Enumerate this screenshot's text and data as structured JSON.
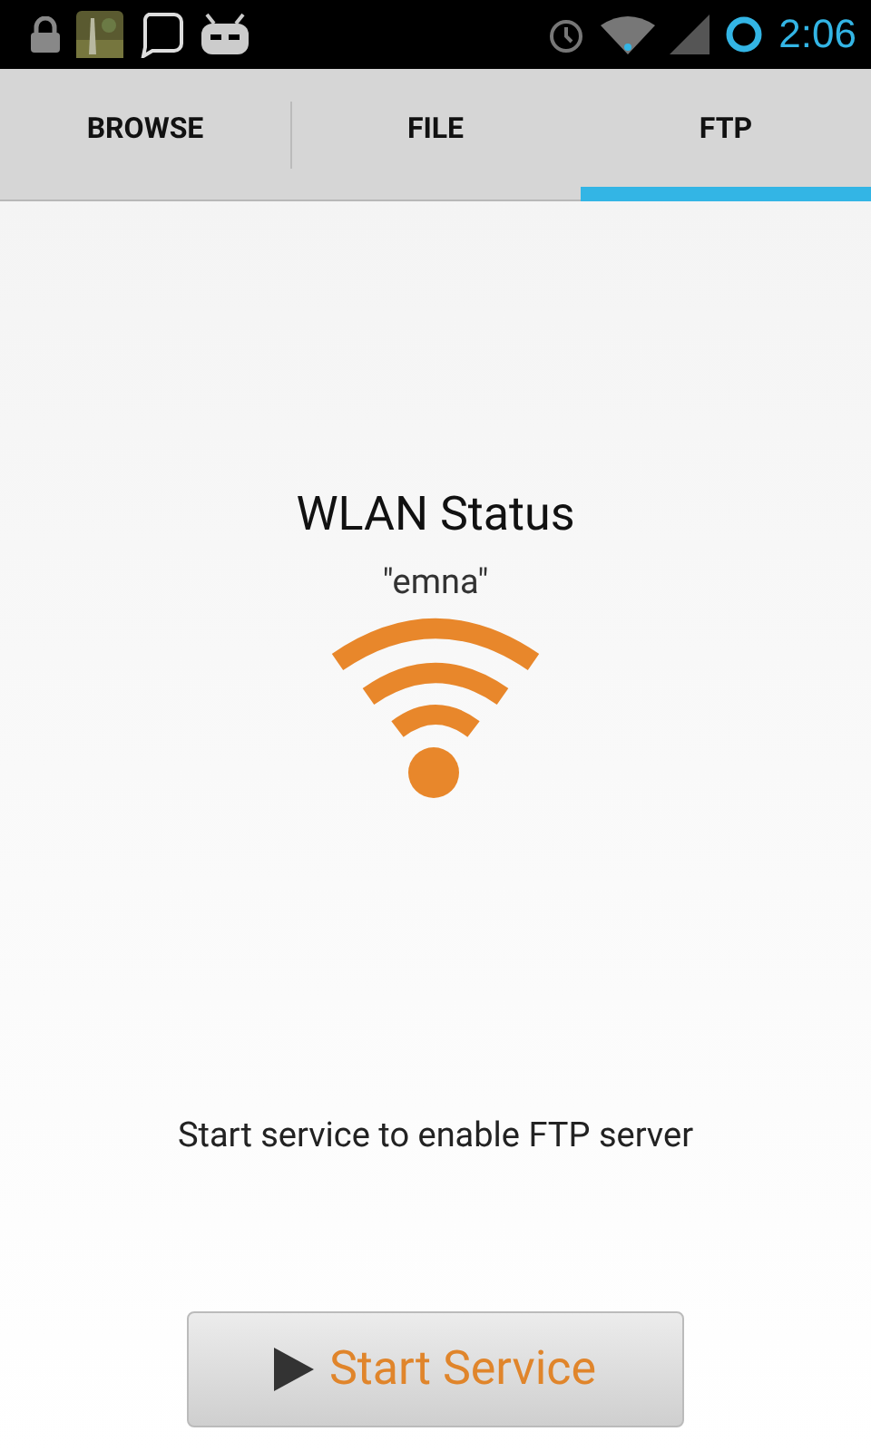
{
  "status_bar": {
    "time": "2:06"
  },
  "tabs": [
    {
      "label": "BROWSE",
      "selected": false
    },
    {
      "label": "FILE",
      "selected": false
    },
    {
      "label": "FTP",
      "selected": true
    }
  ],
  "wlan": {
    "title": "WLAN Status",
    "network": "\"emna\""
  },
  "message": "Start service to enable FTP server",
  "button": {
    "label": "Start Service"
  }
}
